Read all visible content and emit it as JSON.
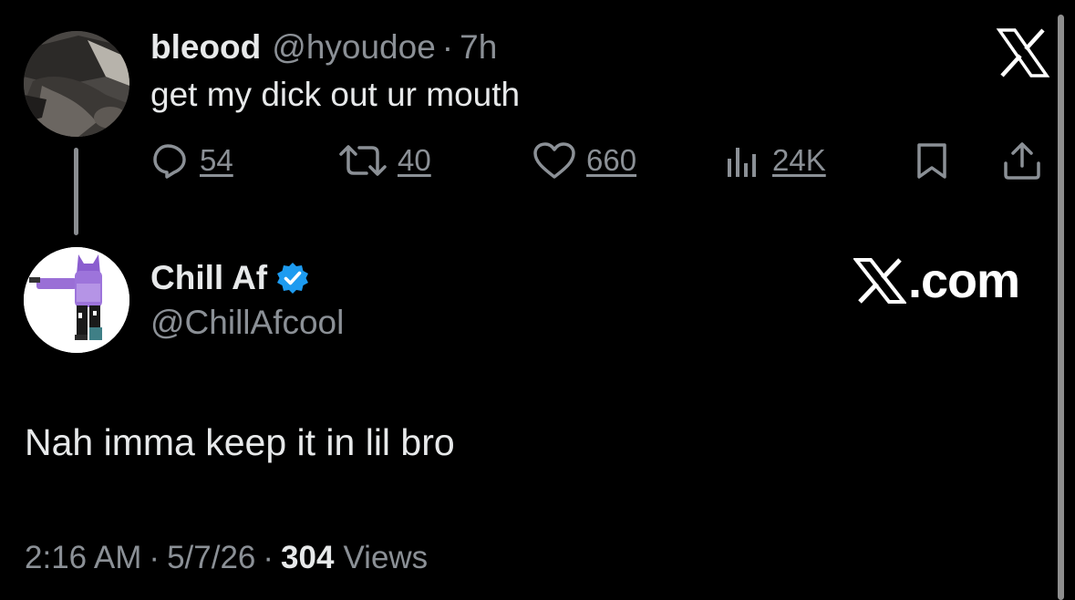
{
  "parent_tweet": {
    "display_name": "bleood",
    "handle": "@hyoudoe",
    "separator": "·",
    "time_ago": "7h",
    "text": "get my dick out ur mouth",
    "actions": {
      "replies": "54",
      "retweets": "40",
      "likes": "660",
      "views": "24K"
    },
    "avatar_icon": "avatar-image"
  },
  "reply_tweet": {
    "display_name": "Chill Af",
    "handle": "@ChillAfcool",
    "verified": true,
    "verified_color": "#1d9bf0",
    "text": "Nah imma keep it in lil bro",
    "timestamp_time": "2:16 AM",
    "separator": "·",
    "timestamp_date": "5/7/26",
    "views_count": "304",
    "views_label": "Views",
    "avatar_icon": "avatar-image"
  },
  "watermark": {
    "text": ".com",
    "icon": "x-logo-icon"
  },
  "colors": {
    "background": "#000000",
    "primary_text": "#e7e9ea",
    "secondary_text": "#8b9096",
    "accent": "#1d9bf0"
  }
}
